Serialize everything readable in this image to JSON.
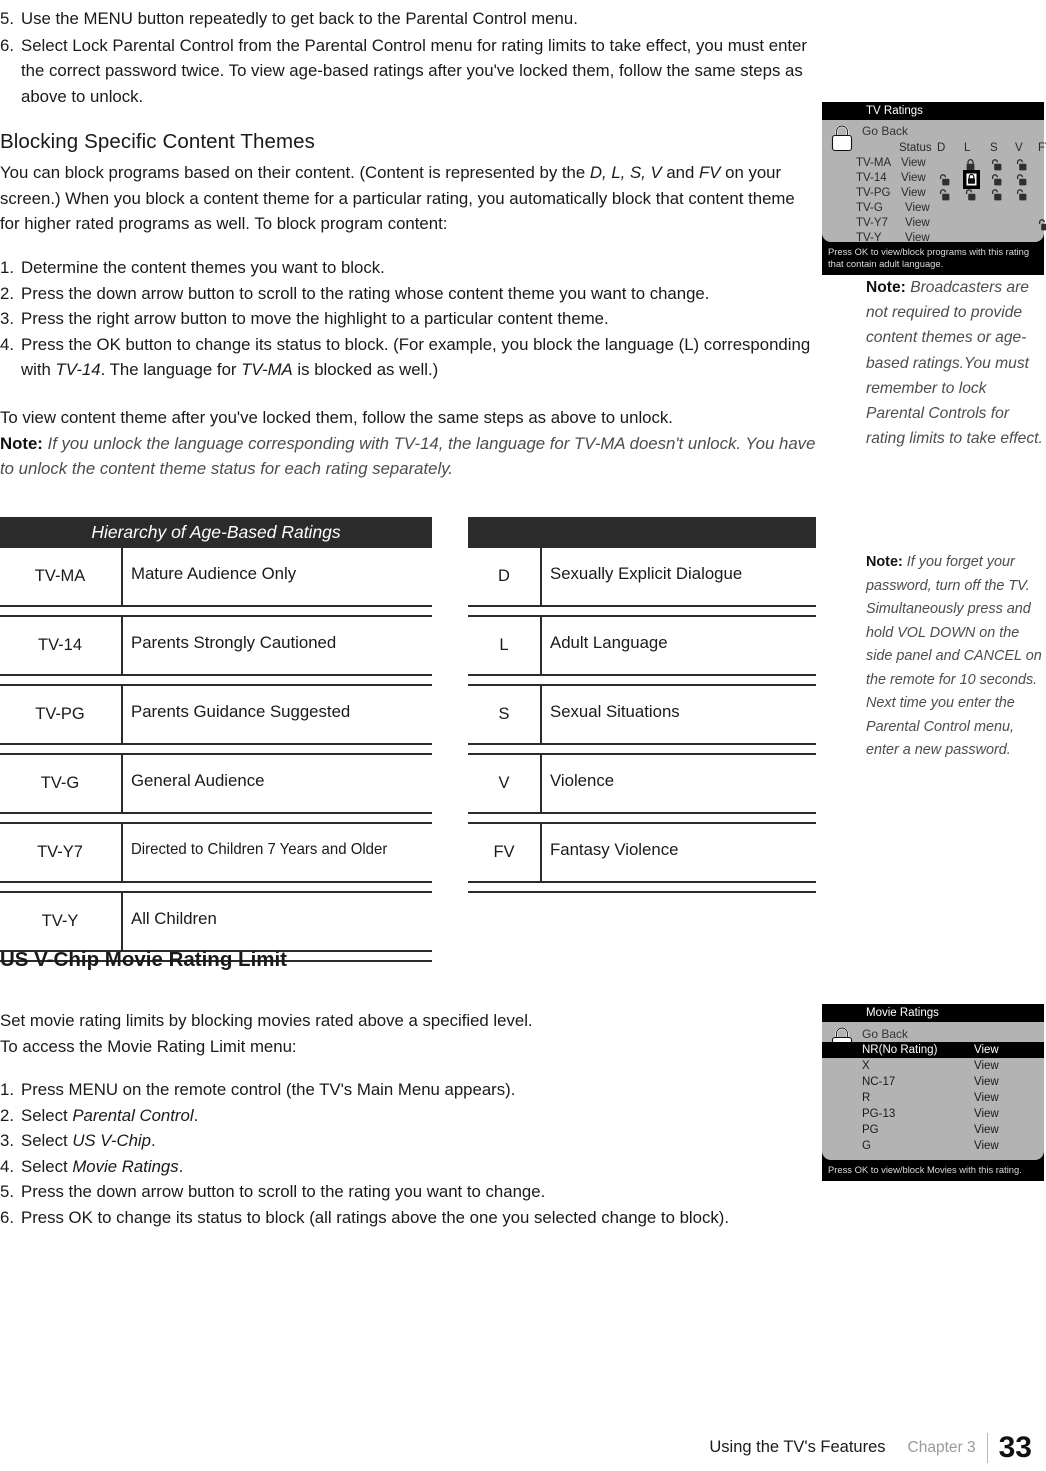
{
  "steps_top": [
    {
      "num": "5.",
      "text": "Use the MENU button repeatedly to get back to the Parental Control menu."
    },
    {
      "num": "6.",
      "text": "Select Lock Parental Control from the Parental Control menu for rating limits to take effect, you must enter the correct password twice. To view age-based ratings after you've locked them, follow the same steps as above to unlock."
    }
  ],
  "section_blocking": {
    "heading": "Blocking Specific Content Themes",
    "para_1a": "You can block programs based on their content. (Content is represented by the ",
    "para_1_italic1": "D, L, S, V",
    "para_1b": " and ",
    "para_1_italic2": "FV",
    "para_1c": " on your screen.) When you block a content theme for a particular rating, you automatically block that content theme for higher rated programs as well. To block program content:",
    "steps": [
      {
        "num": "1.",
        "text": "Determine the content themes you want to block."
      },
      {
        "num": "2.",
        "text": "Press the down arrow button to scroll to the rating whose content theme you want to change."
      },
      {
        "num": "3.",
        "text": "Press the right arrow button to move the highlight to a particular content theme."
      },
      {
        "num": "4.",
        "text": "Press the OK button to change its status to block. (For example, you block the  language (L) corresponding with TV-14. The language for TV-MA is blocked as well.)"
      }
    ],
    "step4_parts": {
      "a": "Press the OK button to change its status to block. (For example, you block the  language (L) corresponding with ",
      "i1": "TV-14",
      "b": ". The language for ",
      "i2": "TV-MA",
      "c": " is blocked as well.)"
    },
    "closing": "To view content theme after you've locked them, follow the same steps as above to unlock.",
    "note_label": "Note:",
    "note_text": " If you unlock the language corresponding with TV-14, the language for TV-MA doesn't unlock. You have to unlock the content theme status for each rating separately."
  },
  "table_age": {
    "header": "Hierarchy of Age-Based Ratings",
    "rows": [
      {
        "code": "TV-MA",
        "desc": "Mature Audience Only"
      },
      {
        "code": "TV-14",
        "desc": "Parents Strongly Cautioned"
      },
      {
        "code": "TV-PG",
        "desc": "Parents Guidance Suggested"
      },
      {
        "code": "TV-G",
        "desc": "General Audience"
      },
      {
        "code": "TV-Y7",
        "desc": "Directed to Children 7 Years and Older"
      },
      {
        "code": "TV-Y",
        "desc": "All Children"
      }
    ]
  },
  "table_themes": {
    "header": "",
    "rows": [
      {
        "code": "D",
        "desc": "Sexually Explicit Dialogue"
      },
      {
        "code": "L",
        "desc": "Adult Language"
      },
      {
        "code": "S",
        "desc": "Sexual Situations"
      },
      {
        "code": "V",
        "desc": "Violence"
      },
      {
        "code": "FV",
        "desc": "Fantasy Violence"
      }
    ]
  },
  "note_1": {
    "label": "Note:",
    "text": " Broadcasters are not required to provide content themes or age-based ratings.You must remember to lock Parental Controls for rating limits to take effect."
  },
  "note_2": {
    "label": "Note:",
    "text": " If you forget your password, turn off the TV. Simultaneously press and hold VOL DOWN on the side panel and CANCEL on the remote for 10 seconds. Next time you enter the Parental Control menu, enter a new password."
  },
  "osd_tv": {
    "title": "TV Ratings",
    "go_back": "Go Back",
    "columns": [
      "Status",
      "D",
      "L",
      "S",
      "V",
      "FV"
    ],
    "ratings": [
      "TV-MA",
      "TV-14",
      "TV-PG",
      "TV-G",
      "TV-Y7",
      "TV-Y"
    ],
    "status_values": [
      "View",
      "View",
      "View",
      "View",
      "View",
      "View"
    ],
    "footer": "Press OK to view/block programs with this rating that contain adult language.",
    "locks": [
      {
        "row": "TV-MA",
        "col": "L",
        "state": "closed",
        "selected": false
      },
      {
        "row": "TV-MA",
        "col": "S",
        "state": "open",
        "selected": false
      },
      {
        "row": "TV-MA",
        "col": "V",
        "state": "open",
        "selected": false
      },
      {
        "row": "TV-14",
        "col": "D",
        "state": "open",
        "selected": false
      },
      {
        "row": "TV-14",
        "col": "L",
        "state": "closed",
        "selected": true
      },
      {
        "row": "TV-14",
        "col": "S",
        "state": "open",
        "selected": false
      },
      {
        "row": "TV-14",
        "col": "V",
        "state": "open",
        "selected": false
      },
      {
        "row": "TV-PG",
        "col": "D",
        "state": "open",
        "selected": false
      },
      {
        "row": "TV-PG",
        "col": "L",
        "state": "open",
        "selected": false
      },
      {
        "row": "TV-PG",
        "col": "S",
        "state": "open",
        "selected": false
      },
      {
        "row": "TV-PG",
        "col": "V",
        "state": "open",
        "selected": false
      },
      {
        "row": "TV-Y7",
        "col": "FV",
        "state": "open",
        "selected": false
      }
    ]
  },
  "section_movie": {
    "heading": "US V-Chip Movie Rating Limit",
    "para_1": "Set movie rating limits by blocking movies rated above a specified level.",
    "para_2": "To access the Movie Rating Limit menu:",
    "steps": [
      {
        "num": "1.",
        "a": "Press MENU on the remote control (the TV's Main Menu appears).",
        "i": "",
        "c": ""
      },
      {
        "num": "2.",
        "a": "Select ",
        "i": "Parental Control",
        "c": "."
      },
      {
        "num": "3.",
        "a": "Select ",
        "i": "US V-Chip",
        "c": "."
      },
      {
        "num": "4.",
        "a": "Select ",
        "i": "Movie Ratings",
        "c": "."
      },
      {
        "num": "5.",
        "a": "Press the down arrow button to scroll to the rating you want to change.",
        "i": "",
        "c": ""
      },
      {
        "num": "6.",
        "a": "Press OK to change its status to block (all ratings above the one you selected change to block).",
        "i": "",
        "c": ""
      }
    ]
  },
  "osd_movie": {
    "title": "Movie Ratings",
    "go_back": "Go Back",
    "rows": [
      {
        "name": "NR(No Rating)",
        "status": "View",
        "selected": true
      },
      {
        "name": "X",
        "status": "View",
        "selected": false
      },
      {
        "name": "NC-17",
        "status": "View",
        "selected": false
      },
      {
        "name": "R",
        "status": "View",
        "selected": false
      },
      {
        "name": "PG-13",
        "status": "View",
        "selected": false
      },
      {
        "name": "PG",
        "status": "View",
        "selected": false
      },
      {
        "name": "G",
        "status": "View",
        "selected": false
      }
    ],
    "footer": "Press OK to view/block Movies with this rating."
  },
  "footer": {
    "title": "Using the TV's Features",
    "chapter": "Chapter 3",
    "page": "33"
  },
  "colors": {
    "table_header_bg": "#2b2b2b",
    "osd_body_bg": "#b3b3b3",
    "osd_bar_bg": "#000000",
    "note_text": "#4d4d4d",
    "chapter_gray": "#9a9a9a"
  }
}
